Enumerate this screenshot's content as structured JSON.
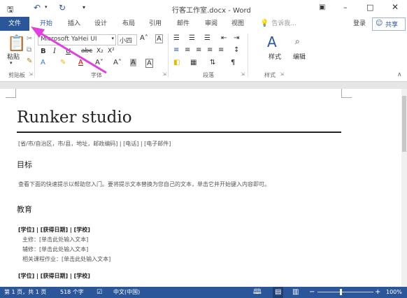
{
  "title_bar": {
    "title": "行客工作室.docx - Word",
    "save_icon": "save-icon",
    "undo_icon": "undo-icon",
    "redo_icon": "redo-icon"
  },
  "tabs": {
    "file": "文件",
    "items": [
      "开始",
      "插入",
      "设计",
      "布局",
      "引用",
      "邮件",
      "审阅",
      "视图"
    ],
    "tell_me": "告诉我...",
    "signin": "登录",
    "share": "共享"
  },
  "ribbon": {
    "paste": "粘贴",
    "font_name": "Microsoft YaHei UI",
    "font_size": "小四",
    "styles": "样式",
    "editing": "编辑",
    "groups": [
      "剪贴板",
      "字体",
      "段落",
      "样式"
    ]
  },
  "document": {
    "name": "Runker studio",
    "address_line": "[省/市/自治区，市/县，地址，邮政编码] | [电话] | [电子邮件]",
    "objective_heading": "目标",
    "objective_text": "查看下面的快速提示以帮助您入门。要将提示文本替换为您自己的文本，单击它并开始键入内容即可。",
    "education_heading": "教育",
    "edu_line1": "[学位] | [获得日期] | [学校]",
    "major": "主修：[单击此处输入文本]",
    "minor": "辅修：[单击此处输入文本]",
    "courses": "相关课程作业：[单击此处输入文本]",
    "edu_line2": "[学位] | [获得日期] | [学校]"
  },
  "status_bar": {
    "page": "第 1 页，共 1 页",
    "words": "518 个字",
    "language": "中文(中国)",
    "zoom": "100%"
  },
  "colors": {
    "accent": "#2b579a",
    "arrow": "#e040e0"
  }
}
